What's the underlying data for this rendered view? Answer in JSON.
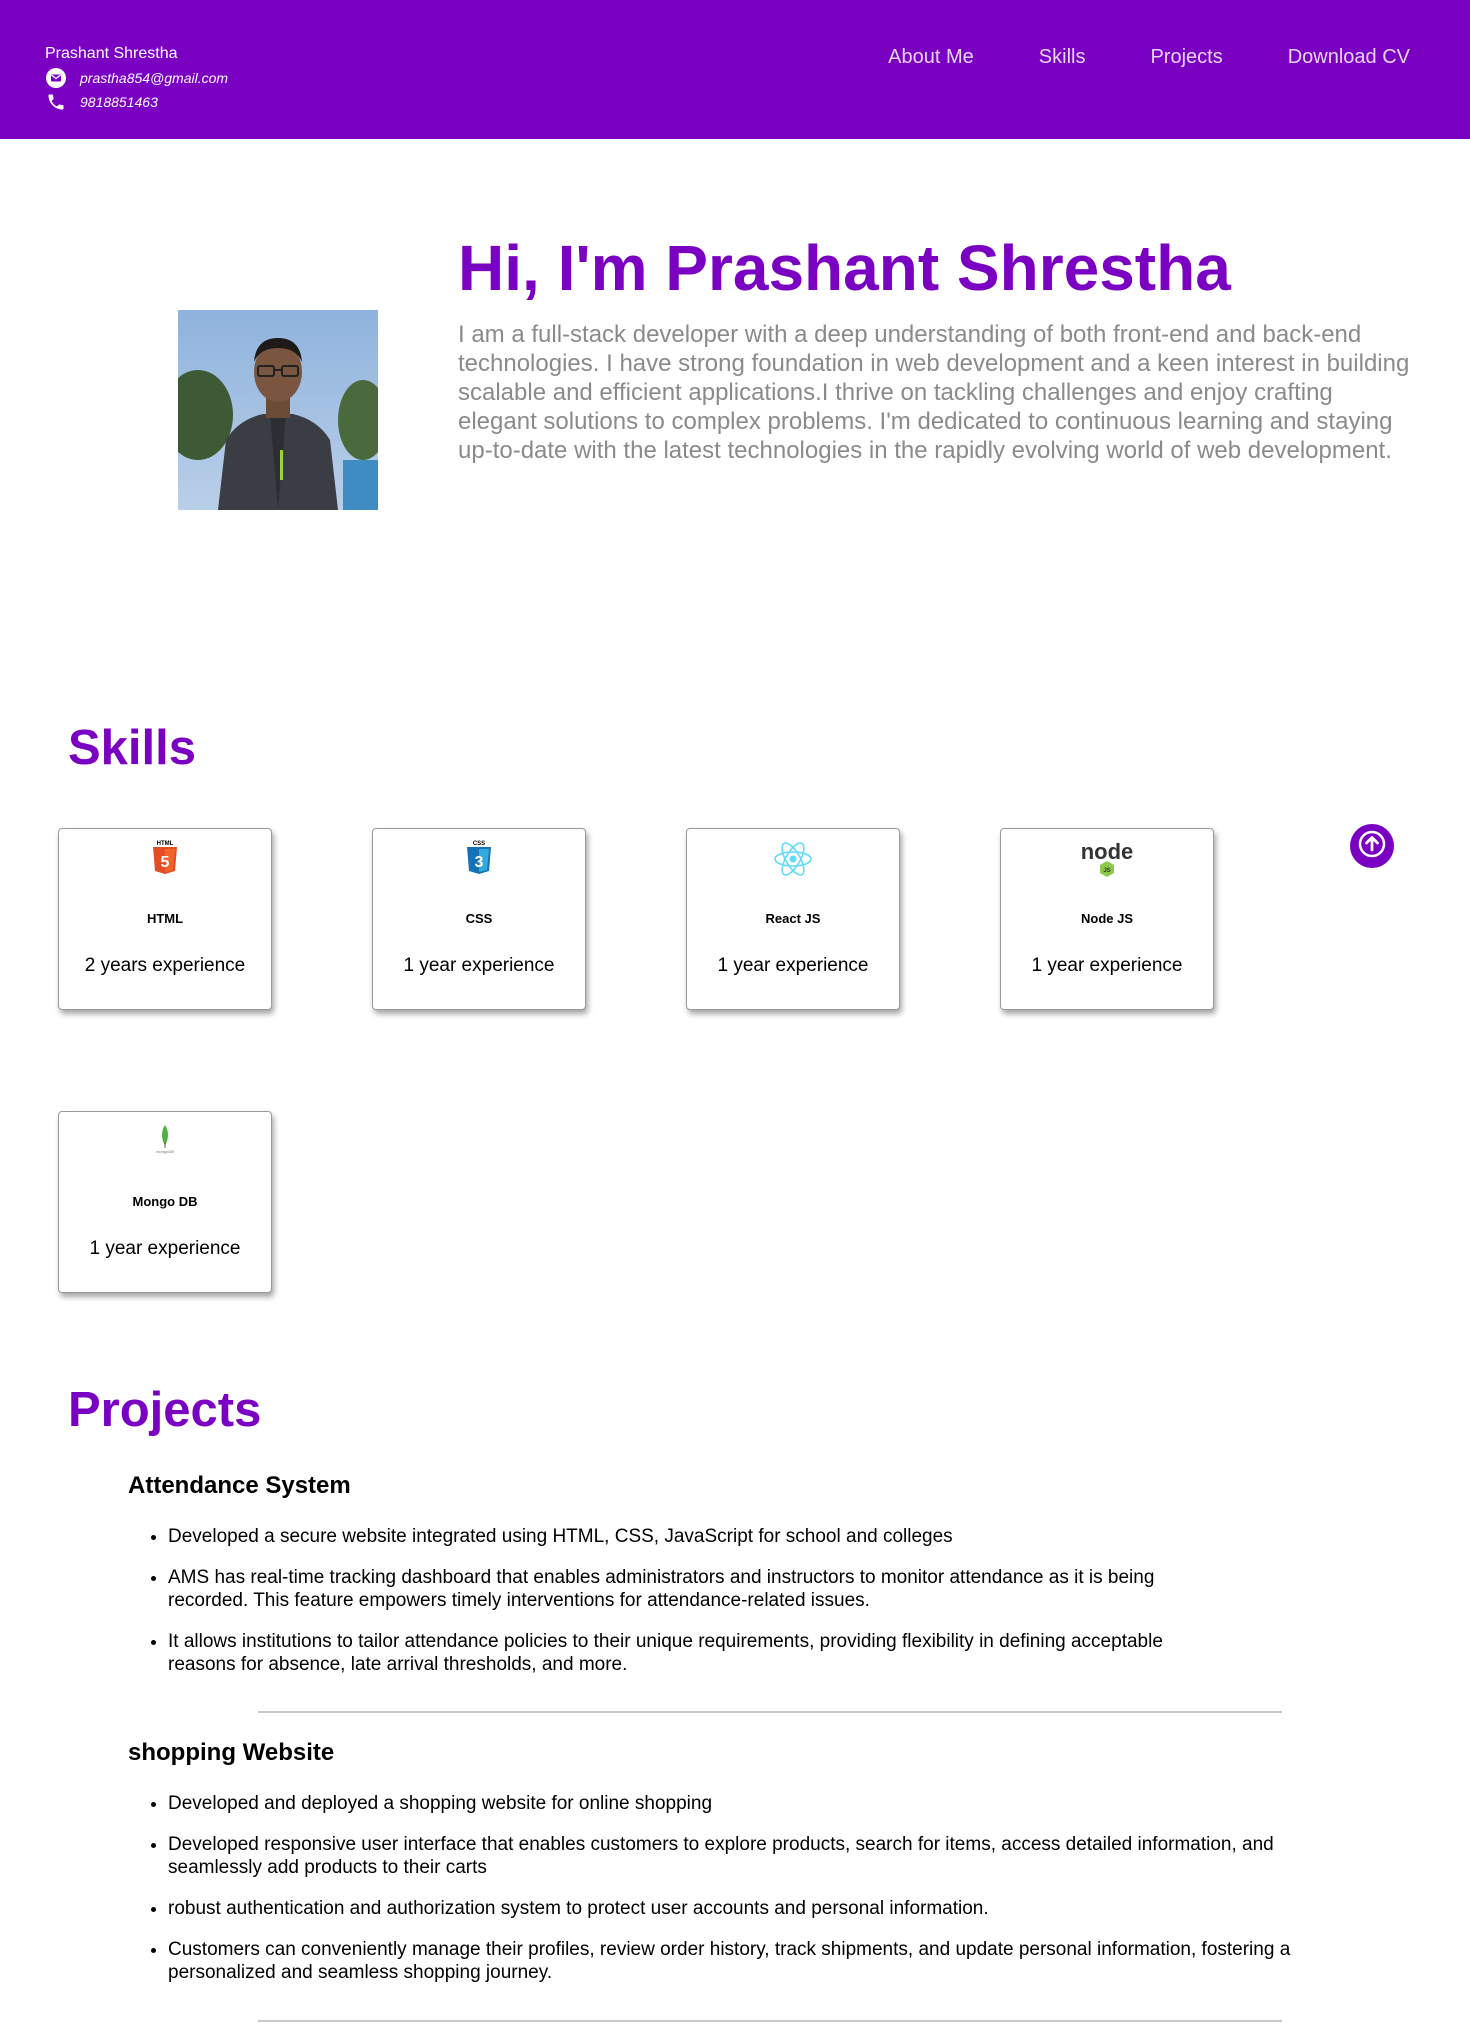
{
  "header": {
    "name": "Prashant Shrestha",
    "email": "prastha854@gmail.com",
    "phone": "9818851463",
    "nav": [
      "About Me",
      "Skills",
      "Projects",
      "Download CV"
    ]
  },
  "hero": {
    "title": "Hi, I'm Prashant Shrestha",
    "description": "I am a full-stack developer with a deep understanding of both front-end and back-end technologies. I have strong foundation in web development and a keen interest in building scalable and efficient applications.I thrive on tackling challenges and enjoy crafting elegant solutions to complex problems. I'm dedicated to continuous learning and staying up-to-date with the latest technologies in the rapidly evolving world of web development."
  },
  "skills": {
    "title": "Skills",
    "items": [
      {
        "name": "HTML",
        "experience": "2 years experience",
        "icon": "html5-icon"
      },
      {
        "name": "CSS",
        "experience": "1 year experience",
        "icon": "css3-icon"
      },
      {
        "name": "React JS",
        "experience": "1 year experience",
        "icon": "react-icon"
      },
      {
        "name": "Node JS",
        "experience": "1 year experience",
        "icon": "nodejs-icon"
      },
      {
        "name": "Mongo DB",
        "experience": "1 year experience",
        "icon": "mongodb-icon"
      }
    ]
  },
  "projects": {
    "title": "Projects",
    "items": [
      {
        "name": "Attendance System",
        "bullets": [
          "Developed a secure website integrated using HTML, CSS, JavaScript for school and colleges",
          "AMS has real-time tracking dashboard that enables administrators and instructors to monitor attendance as it is being recorded. This feature empowers timely interventions for attendance-related issues.",
          "It allows institutions to tailor attendance policies to their unique requirements, providing flexibility in defining acceptable reasons for absence, late arrival thresholds, and more."
        ]
      },
      {
        "name": "shopping Website",
        "bullets": [
          "Developed and deployed a shopping website for online shopping",
          "Developed responsive user interface that enables customers to explore products, search for items, access detailed information, and seamlessly add products to their carts",
          "robust authentication and authorization system to protect user accounts and personal information.",
          "Customers can conveniently manage their profiles, review order history, track shipments, and update personal information, fostering a personalized and seamless shopping journey."
        ]
      }
    ]
  },
  "colors": {
    "accent": "#7a00c2",
    "muted_text": "#8a8a8a"
  }
}
